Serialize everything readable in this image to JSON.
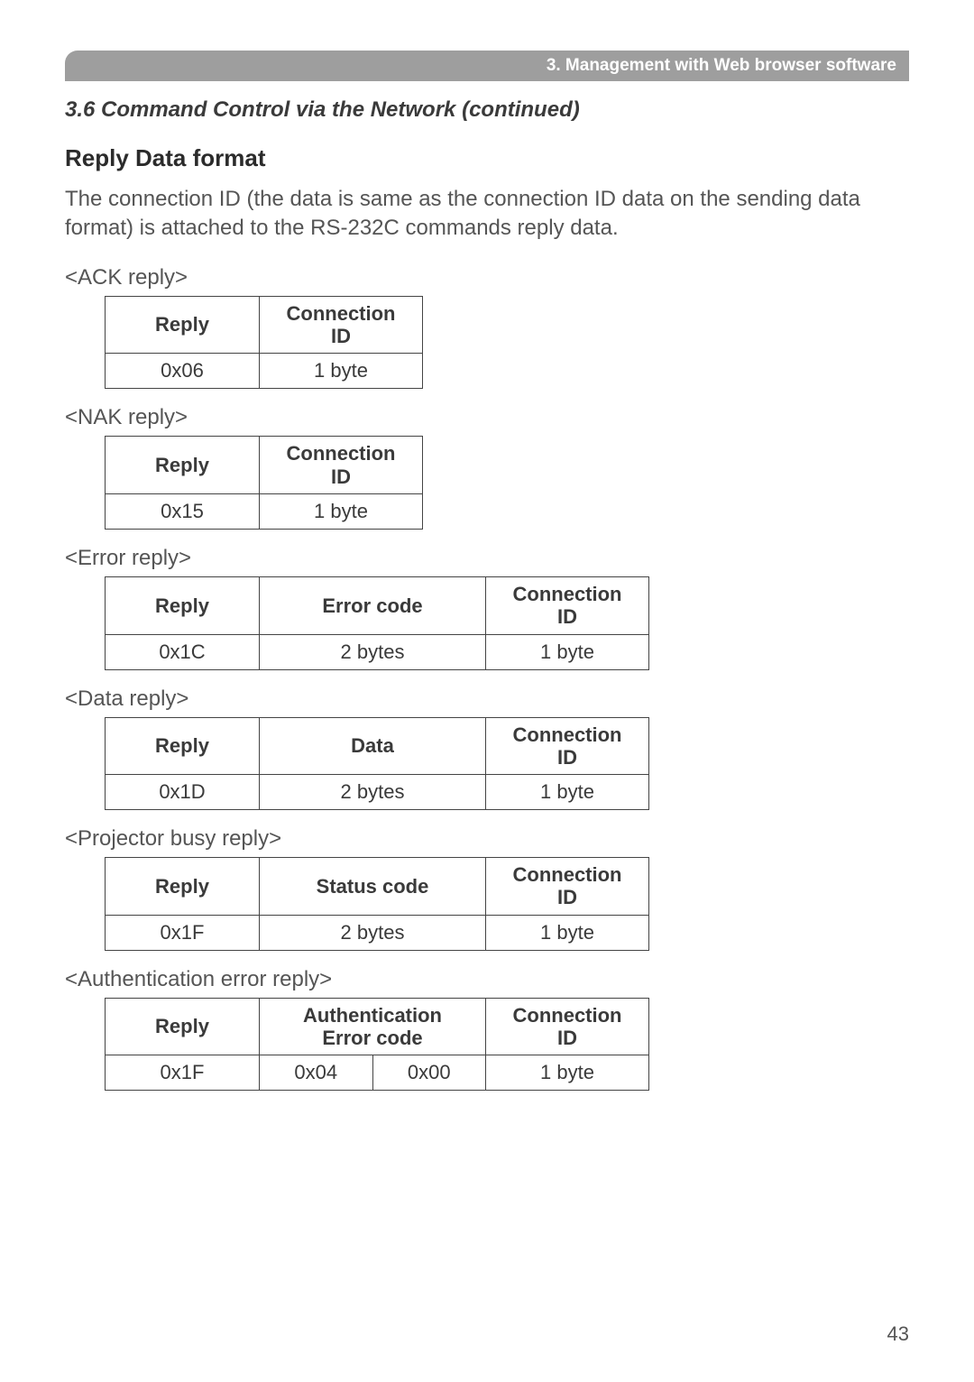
{
  "banner": "3. Management with Web browser software",
  "subtitle": "3.6 Command Control via the Network (continued)",
  "section_heading": "Reply Data format",
  "intro": "The connection ID (the data is same as the connection ID data on the sending data format) is attached to the RS-232C commands reply data.",
  "tables": {
    "ack": {
      "label": "<ACK reply>",
      "headers": [
        "Reply",
        "Connection\nID"
      ],
      "row": [
        "0x06",
        "1 byte"
      ]
    },
    "nak": {
      "label": "<NAK reply>",
      "headers": [
        "Reply",
        "Connection\nID"
      ],
      "row": [
        "0x15",
        "1 byte"
      ]
    },
    "error": {
      "label": "<Error reply>",
      "headers": [
        "Reply",
        "Error code",
        "Connection\nID"
      ],
      "row": [
        "0x1C",
        "2 bytes",
        "1 byte"
      ]
    },
    "data": {
      "label": "<Data reply>",
      "headers": [
        "Reply",
        "Data",
        "Connection\nID"
      ],
      "row": [
        "0x1D",
        "2 bytes",
        "1 byte"
      ]
    },
    "busy": {
      "label": "<Projector busy reply>",
      "headers": [
        "Reply",
        "Status code",
        "Connection\nID"
      ],
      "row": [
        "0x1F",
        "2 bytes",
        "1 byte"
      ]
    },
    "auth": {
      "label": "<Authentication error reply>",
      "headers": [
        "Reply",
        "Authentication\nError code",
        "Connection\nID"
      ],
      "row": [
        "0x1F",
        "0x04",
        "0x00",
        "1 byte"
      ]
    }
  },
  "page_number": "43"
}
